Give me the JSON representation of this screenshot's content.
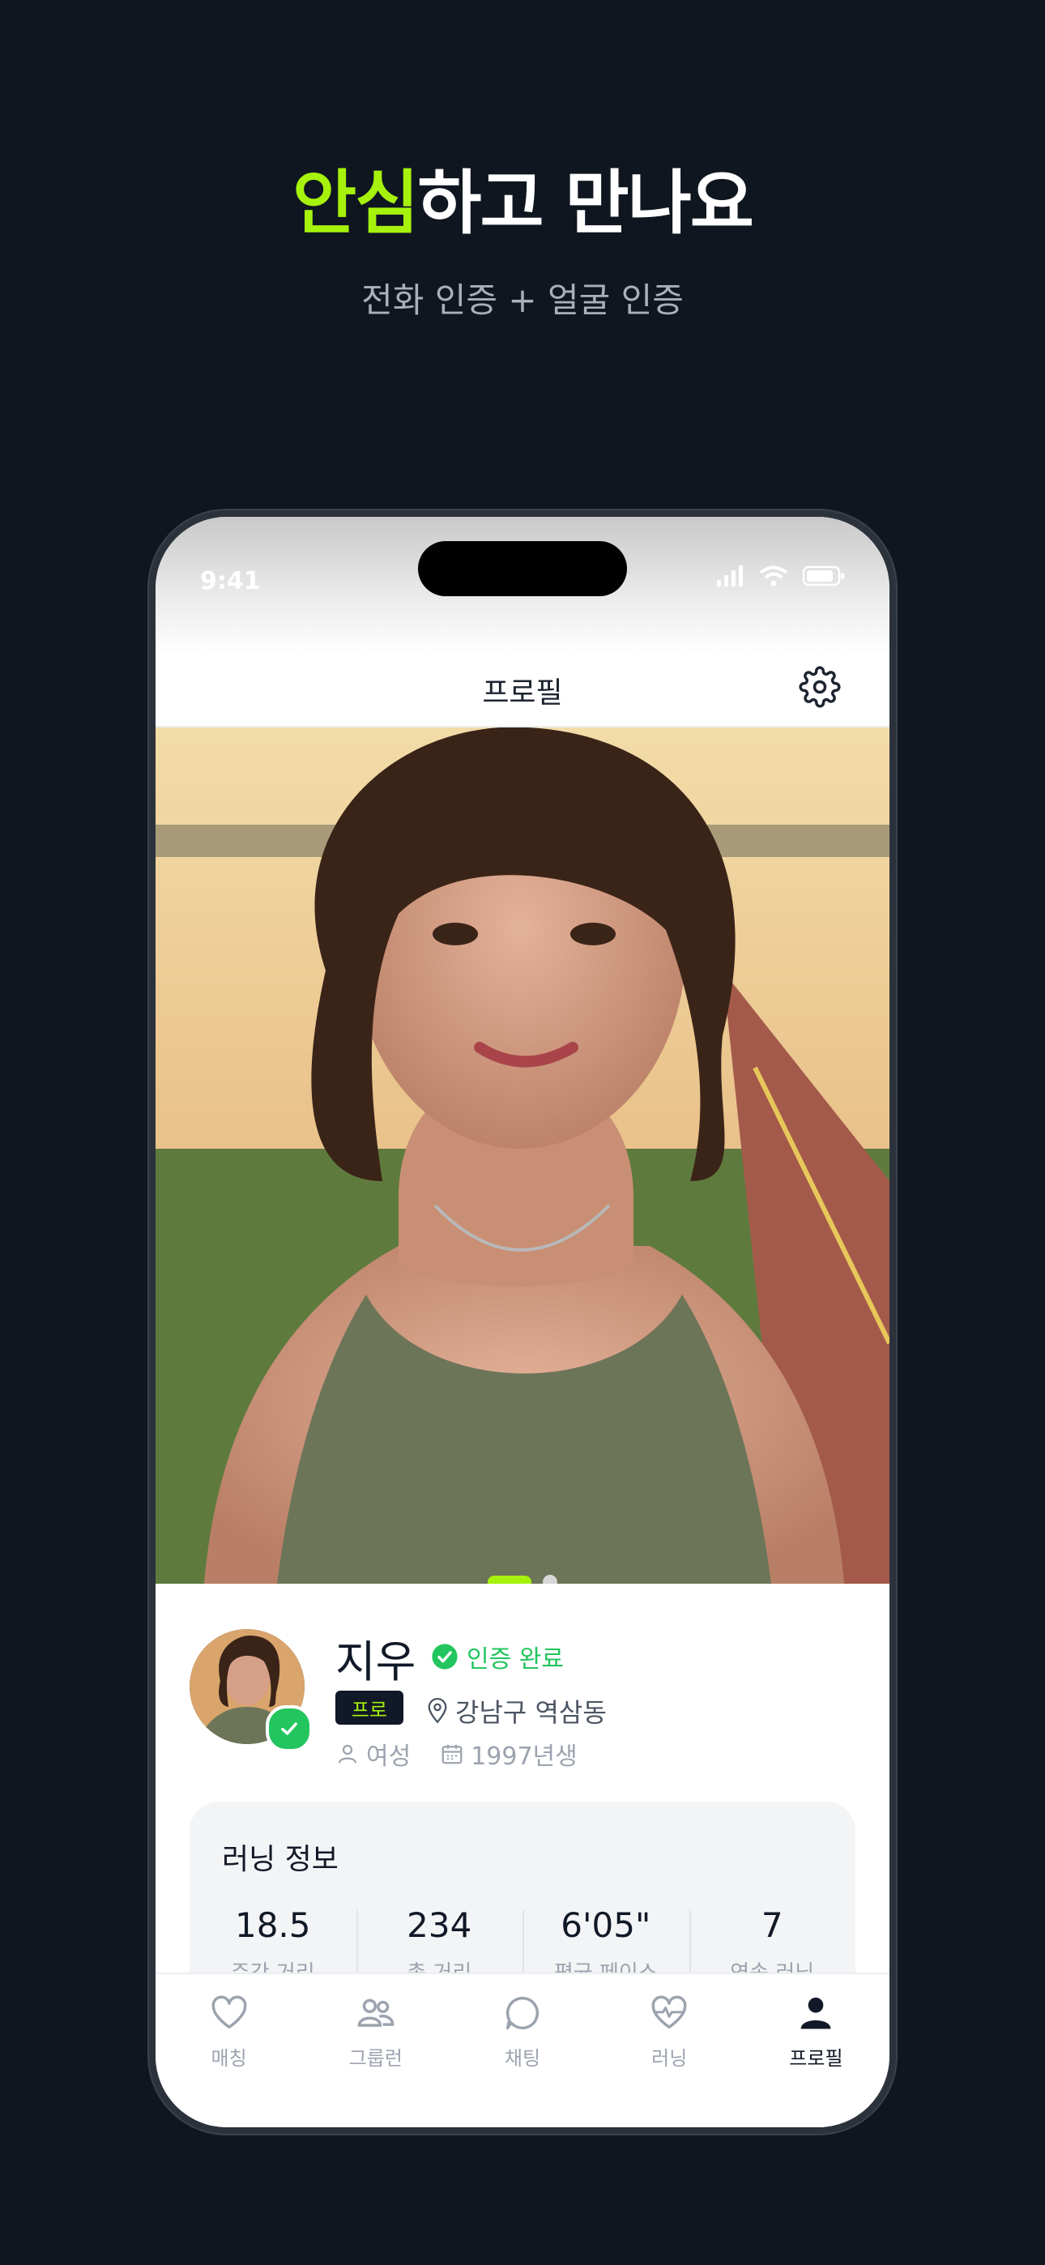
{
  "hero": {
    "title_accent": "안심",
    "title_rest": "하고 만나요",
    "subtitle": "전화 인증 + 얼굴 인증"
  },
  "status_bar": {
    "time": "9:41"
  },
  "header": {
    "title": "프로필",
    "settings_icon": "gear-icon"
  },
  "photo": {
    "pages": 2,
    "current_page": 1
  },
  "profile": {
    "name": "지우",
    "verified_label": "인증 완료",
    "badge": "프로",
    "location": "강남구 역삼동",
    "gender": "여성",
    "birth": "1997년생"
  },
  "running_info": {
    "title": "러닝 정보",
    "stats": [
      {
        "value": "18.5",
        "label": "주간 거리"
      },
      {
        "value": "234",
        "label": "총 거리"
      },
      {
        "value": "6'05\"",
        "label": "평균 페이스"
      },
      {
        "value": "7",
        "label": "연속 러닝"
      }
    ]
  },
  "tabs": [
    {
      "label": "매칭",
      "icon": "heart-icon"
    },
    {
      "label": "그룹런",
      "icon": "group-icon"
    },
    {
      "label": "채팅",
      "icon": "chat-icon"
    },
    {
      "label": "러닝",
      "icon": "pulse-heart-icon"
    },
    {
      "label": "프로필",
      "icon": "person-icon",
      "active": true
    }
  ],
  "colors": {
    "accent": "#a6f20d",
    "verified": "#22c55e",
    "background": "#0f1620"
  }
}
